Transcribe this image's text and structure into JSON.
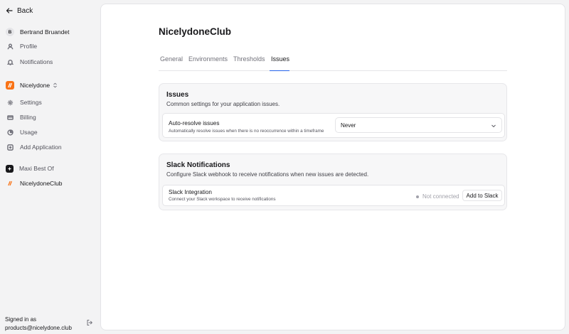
{
  "sidebar": {
    "back_label": "Back",
    "user": {
      "initial": "B",
      "name": "Bertrand Bruandet"
    },
    "user_items": [
      {
        "label": "Profile",
        "icon": "user-icon"
      },
      {
        "label": "Notifications",
        "icon": "bell-icon"
      }
    ],
    "app_switcher": {
      "label": "Nicelydone"
    },
    "app_items": [
      {
        "label": "Settings",
        "icon": "gear-icon"
      },
      {
        "label": "Billing",
        "icon": "credit-card-icon"
      },
      {
        "label": "Usage",
        "icon": "chart-pie-icon"
      },
      {
        "label": "Add Application",
        "icon": "plus-circle-icon"
      }
    ],
    "apps": [
      {
        "label": "Maxi Best Of"
      },
      {
        "label": "NicelydoneClub"
      }
    ],
    "signed_in_label": "Signed in as",
    "signed_in_email": "products@nicelydone.club"
  },
  "main": {
    "title": "NicelydoneClub",
    "tabs": [
      {
        "label": "General"
      },
      {
        "label": "Environments"
      },
      {
        "label": "Thresholds"
      },
      {
        "label": "Issues",
        "active": true
      }
    ],
    "issues_card": {
      "title": "Issues",
      "subtitle": "Common settings for your application issues.",
      "auto_resolve": {
        "label": "Auto-resolve issues",
        "help": "Automatically resolve issues when there is no reoccurrence within a timeframe",
        "value": "Never"
      }
    },
    "slack_card": {
      "title": "Slack Notifications",
      "subtitle": "Configure Slack webhook to receive notifications when new issues are detected.",
      "integration": {
        "label": "Slack Integration",
        "help": "Connect your Slack workspace to receive notifications",
        "status": "Not connected",
        "button": "Add to Slack"
      }
    }
  },
  "colors": {
    "accent": "#2563eb",
    "app_logo": "#f97316",
    "background": "#f3f3f4"
  }
}
